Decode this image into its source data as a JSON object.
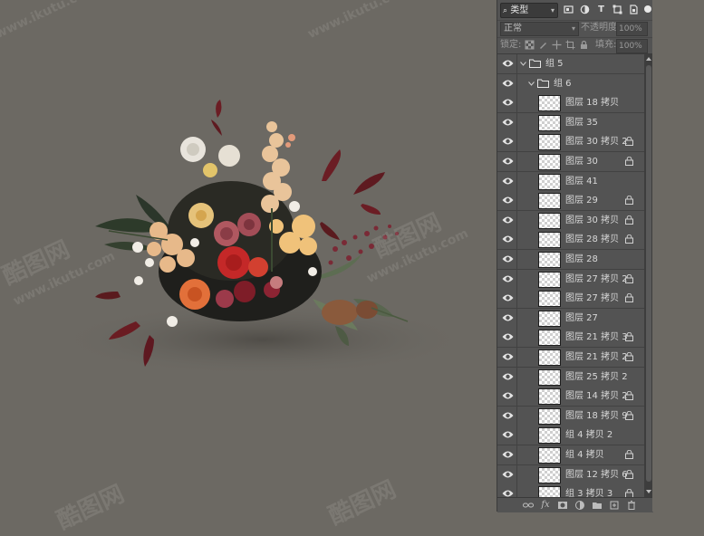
{
  "watermarks": [
    "酷图网",
    "www.ikutu.com"
  ],
  "toolbar": {
    "filter_type_label": "类型",
    "blend_mode": "正常",
    "opacity_label": "不透明度:",
    "opacity_value": "100%",
    "lock_label": "锁定:",
    "fill_label": "填充:",
    "fill_value": "100%"
  },
  "layers": [
    {
      "kind": "group",
      "name": "组 5",
      "indent": 0,
      "expanded": true,
      "locked": false
    },
    {
      "kind": "group",
      "name": "组 6",
      "indent": 1,
      "expanded": true,
      "locked": false
    },
    {
      "kind": "layer",
      "name": "图层 18 拷贝",
      "locked": false
    },
    {
      "kind": "layer",
      "name": "图层 35",
      "locked": false
    },
    {
      "kind": "layer",
      "name": "图层 30 拷贝 2",
      "locked": true
    },
    {
      "kind": "layer",
      "name": "图层 30",
      "locked": true
    },
    {
      "kind": "layer",
      "name": "图层 41",
      "locked": false
    },
    {
      "kind": "layer",
      "name": "图层 29",
      "locked": true
    },
    {
      "kind": "layer",
      "name": "图层 30 拷贝",
      "locked": true
    },
    {
      "kind": "layer",
      "name": "图层 28 拷贝",
      "locked": true
    },
    {
      "kind": "layer",
      "name": "图层 28",
      "locked": false
    },
    {
      "kind": "layer",
      "name": "图层 27 拷贝 2",
      "locked": true
    },
    {
      "kind": "layer",
      "name": "图层 27 拷贝",
      "locked": true
    },
    {
      "kind": "layer",
      "name": "图层 27",
      "locked": false
    },
    {
      "kind": "layer",
      "name": "图层 21 拷贝 3",
      "locked": true
    },
    {
      "kind": "layer",
      "name": "图层 21 拷贝 2",
      "locked": true
    },
    {
      "kind": "layer",
      "name": "图层 25 拷贝 2",
      "locked": false
    },
    {
      "kind": "layer",
      "name": "图层 14 拷贝 2",
      "locked": true
    },
    {
      "kind": "layer",
      "name": "图层 18 拷贝 9",
      "locked": true
    },
    {
      "kind": "layer",
      "name": "组 4 拷贝 2",
      "locked": false
    },
    {
      "kind": "layer",
      "name": "组 4 拷贝",
      "locked": true
    },
    {
      "kind": "layer",
      "name": "图层 12 拷贝 6",
      "locked": true
    },
    {
      "kind": "layer",
      "name": "组 3 拷贝 3",
      "locked": true
    }
  ]
}
